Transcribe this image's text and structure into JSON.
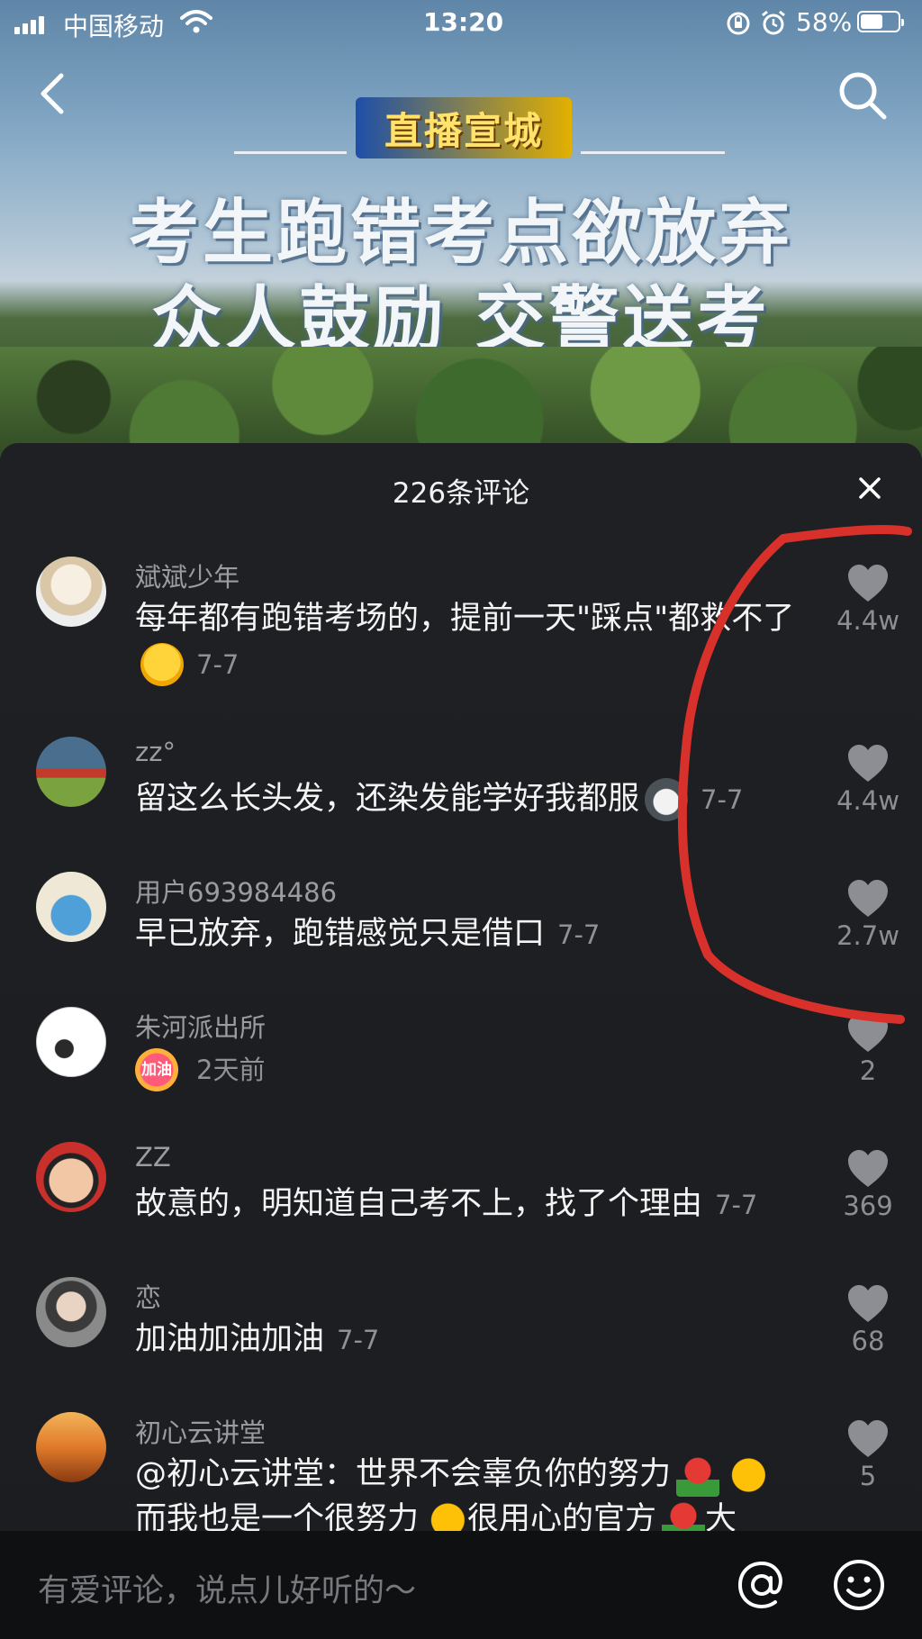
{
  "status_bar": {
    "carrier": "中国移动",
    "time": "13:20",
    "battery_percent": "58%",
    "icons": [
      "signal-icon",
      "wifi-icon",
      "orientation-lock-icon",
      "alarm-icon",
      "battery-icon"
    ]
  },
  "video": {
    "logo_text": "直播宣城",
    "headline_line1": "考生跑错考点欲放弃",
    "headline_line2": "众人鼓励  交警送考"
  },
  "nav": {
    "back_icon": "chevron-left-icon",
    "search_icon": "search-icon"
  },
  "comments_panel": {
    "title": "226条评论",
    "close_icon": "close-icon",
    "comments": [
      {
        "username": "斌斌少年",
        "text": "每年都有跑错考场的，提前一天\"踩点\"都救不了",
        "emoji": "rolling-laugh-emoji",
        "date": "7-7",
        "likes": "4.4w"
      },
      {
        "username": "zz°",
        "text": "留这么长头发，还染发能学好我都服",
        "emoji": "husky-emoji",
        "date": "7-7",
        "likes": "4.4w"
      },
      {
        "username": "用户693984486",
        "text": "早已放弃，跑错感觉只是借口",
        "date": "7-7",
        "likes": "2.7w"
      },
      {
        "username": "朱河派出所",
        "text": "",
        "emoji": "jiayou-sticker",
        "emoji_text": "加油",
        "date": "2天前",
        "likes": "2"
      },
      {
        "username": "ZZ",
        "text": "故意的，明知道自己考不上，找了个理由",
        "date": "7-7",
        "likes": "369"
      },
      {
        "username": "恋",
        "text": "加油加油加油",
        "date": "7-7",
        "likes": "68"
      },
      {
        "username": "初心云讲堂",
        "text": "@初心云讲堂：世界不会辜负你的努力",
        "text_line2": "而我也是一个很努力",
        "text_line2b": "很用心的官方",
        "text_line2c": "大",
        "date": "",
        "likes": "5"
      }
    ]
  },
  "input_bar": {
    "placeholder": "有爱评论，说点儿好听的～",
    "at_icon": "at-icon",
    "emoji_icon": "smiley-icon"
  },
  "colors": {
    "sheet_bg": "#1e2024",
    "username": "#9a9ca1",
    "comment_text": "#f4f4f4",
    "like_icon": "#8c8e93",
    "annotation_stroke": "#d8302a"
  }
}
